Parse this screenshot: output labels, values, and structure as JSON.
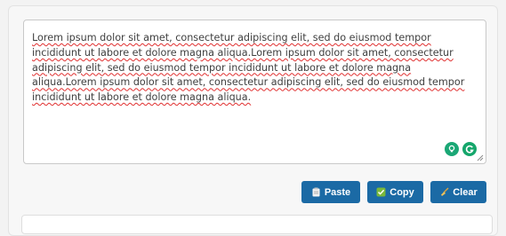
{
  "editor": {
    "content": "Lorem ipsum dolor sit amet, consectetur adipiscing elit, sed do eiusmod tempor incididunt ut labore et dolore magna aliqua.Lorem ipsum dolor sit amet, consectetur adipiscing elit, sed do eiusmod tempor incididunt ut labore et dolore magna aliqua.Lorem ipsum dolor sit amet, consectetur adipiscing elit, sed do eiusmod tempor incididunt ut labore et dolore magna aliqua."
  },
  "toolbar": {
    "paste_label": "Paste",
    "copy_label": "Copy",
    "clear_label": "Clear"
  },
  "icons": {
    "paste": "clipboard-icon",
    "copy": "check-box-icon",
    "clear": "broom-icon",
    "extension_1": "bulb-extension-icon",
    "extension_2": "grammarly-icon"
  },
  "colors": {
    "button": "#1b6aa5",
    "extension": "#15a66b",
    "spellcheck": "#e03030"
  }
}
